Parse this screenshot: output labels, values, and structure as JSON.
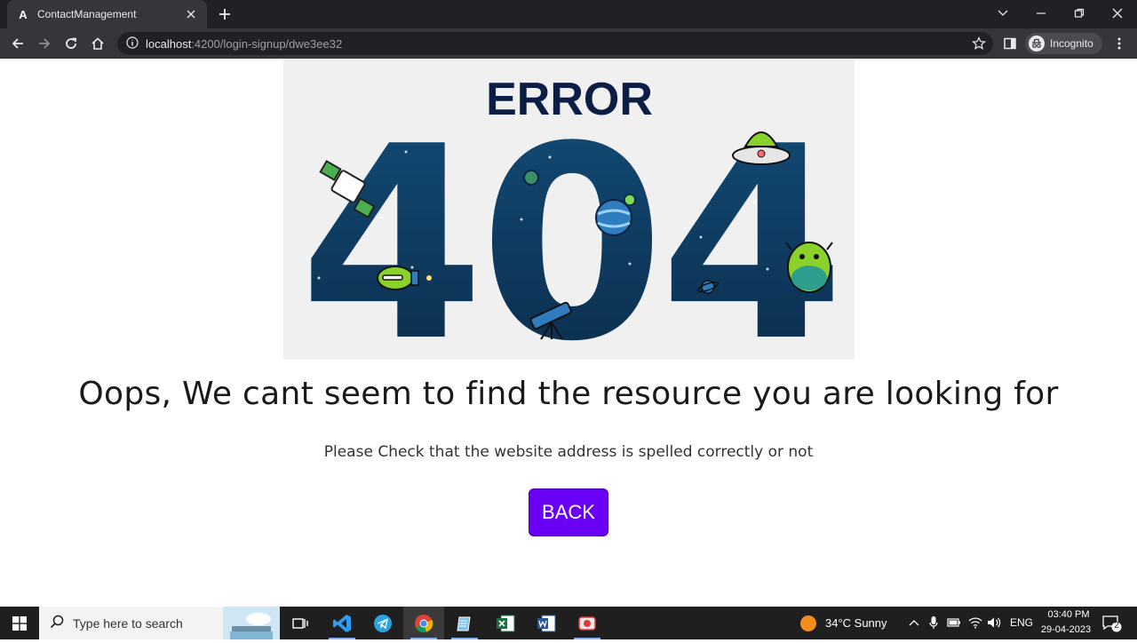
{
  "browser": {
    "tab_title": "ContactManagement",
    "url_host": "localhost",
    "url_rest": ":4200/login-signup/dwe3ee32",
    "profile_label": "Incognito"
  },
  "page": {
    "illustration": {
      "word": "ERROR",
      "code": "404"
    },
    "heading": "Oops, We cant seem to find the resource you are looking for",
    "subtext": "Please Check that the website address is spelled correctly or not",
    "back_label": "BACK"
  },
  "taskbar": {
    "search_placeholder": "Type here to search",
    "weather": "34°C  Sunny",
    "language": "ENG",
    "time": "03:40 PM",
    "date": "29-04-2023",
    "notification_count": "2"
  },
  "colors": {
    "accent": "#6a00f4",
    "illustration_navy": "#0b2a4a"
  }
}
